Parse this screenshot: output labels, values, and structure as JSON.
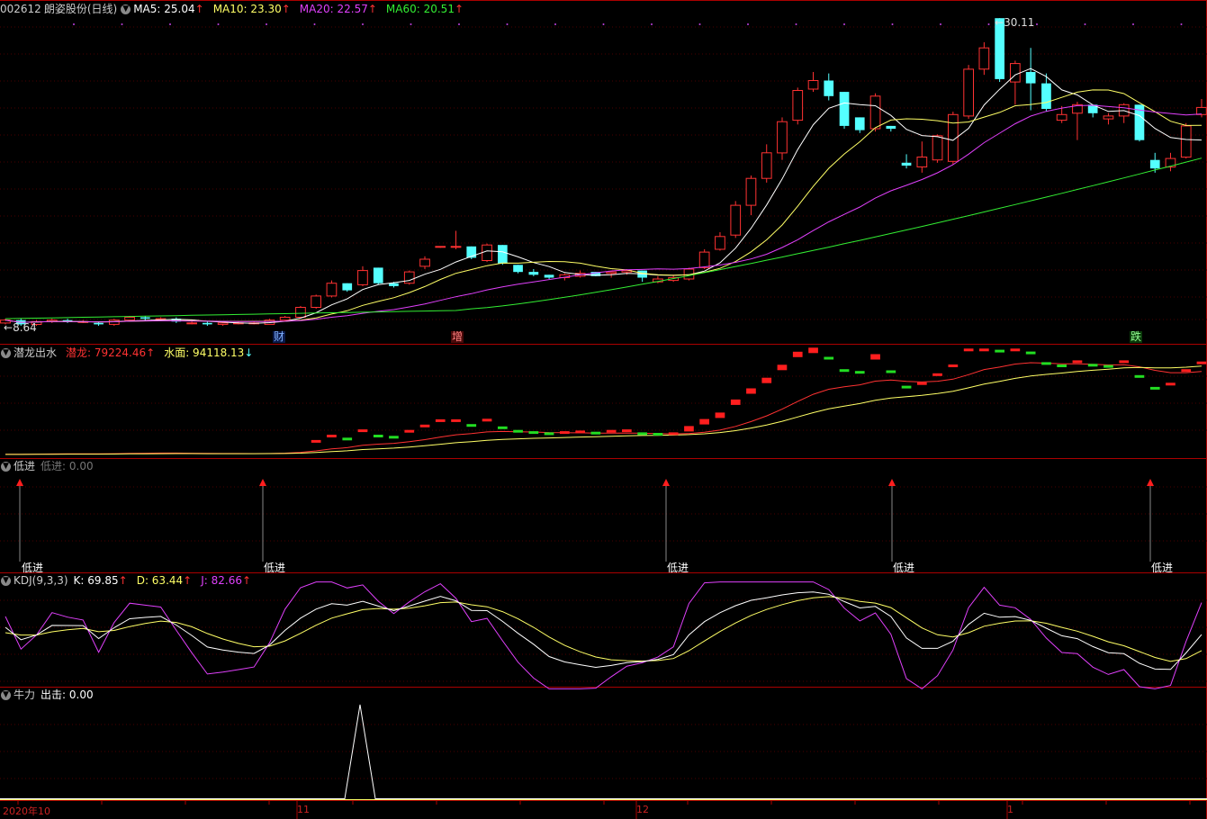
{
  "main": {
    "code": "002612",
    "name": "朗姿股份",
    "period": "(日线)",
    "ma": [
      {
        "label": "MA5: 25.04",
        "arrow": "↑",
        "color": "#ffffff"
      },
      {
        "label": "MA10: 23.30",
        "arrow": "↑",
        "color": "#ffff66"
      },
      {
        "label": "MA20: 22.57",
        "arrow": "↑",
        "color": "#e040fb"
      },
      {
        "label": "MA60: 20.51",
        "arrow": "↑",
        "color": "#33ee33"
      }
    ],
    "high_label": "30.11",
    "low_label": "8.64",
    "events": [
      "财",
      "增",
      "跌"
    ]
  },
  "panel2": {
    "title": "潜龙出水",
    "qianlong": "潜龙: 79224.46",
    "qianlong_arrow": "↑",
    "shuimian": "水面: 94118.13",
    "shuimian_arrow": "↓"
  },
  "panel3": {
    "title": "低进",
    "value": "低进: 0.00",
    "signal_label": "低进"
  },
  "panel4": {
    "title": "KDJ(9,3,3)",
    "k": "K: 69.85",
    "k_arrow": "↑",
    "d": "D: 63.44",
    "d_arrow": "↑",
    "j": "J: 82.66",
    "j_arrow": "↑"
  },
  "panel5": {
    "title": "牛力",
    "value": "出击: 0.00"
  },
  "dates": [
    "2020年10",
    "11",
    "12",
    "1"
  ],
  "colors": {
    "up": "#ff3232",
    "down": "#54ffff",
    "ma5": "#ffffff",
    "ma10": "#ffff66",
    "ma20": "#e040fb",
    "ma60": "#33ee33",
    "divider": "#aa0000"
  },
  "chart_data": {
    "type": "candlestick",
    "candles": [
      [
        8.6,
        8.9,
        8.5,
        8.8
      ],
      [
        8.8,
        8.9,
        8.4,
        8.5
      ],
      [
        8.5,
        8.8,
        8.4,
        8.7
      ],
      [
        8.7,
        8.9,
        8.6,
        8.8
      ],
      [
        8.8,
        8.9,
        8.6,
        8.7
      ],
      [
        8.7,
        8.8,
        8.6,
        8.7
      ],
      [
        8.6,
        8.7,
        8.4,
        8.5
      ],
      [
        8.5,
        8.9,
        8.4,
        8.8
      ],
      [
        8.8,
        9.1,
        8.7,
        9.0
      ],
      [
        9.0,
        9.1,
        8.8,
        8.9
      ],
      [
        8.9,
        9.0,
        8.8,
        8.9
      ],
      [
        8.9,
        9.0,
        8.6,
        8.7
      ],
      [
        8.6,
        8.7,
        8.5,
        8.6
      ],
      [
        8.6,
        8.7,
        8.4,
        8.5
      ],
      [
        8.5,
        8.7,
        8.4,
        8.6
      ],
      [
        8.6,
        8.7,
        8.5,
        8.6
      ],
      [
        8.6,
        8.7,
        8.5,
        8.6
      ],
      [
        8.5,
        8.9,
        8.5,
        8.8
      ],
      [
        8.8,
        9.1,
        8.7,
        9.0
      ],
      [
        9.0,
        9.8,
        9.0,
        9.7
      ],
      [
        9.7,
        10.6,
        9.6,
        10.5
      ],
      [
        10.5,
        11.6,
        10.4,
        11.4
      ],
      [
        11.4,
        11.4,
        10.8,
        10.9
      ],
      [
        11.3,
        12.6,
        11.2,
        12.3
      ],
      [
        12.5,
        12.5,
        11.3,
        11.4
      ],
      [
        11.4,
        11.5,
        11.1,
        11.2
      ],
      [
        11.4,
        12.3,
        11.3,
        12.2
      ],
      [
        12.6,
        13.3,
        12.4,
        13.1
      ],
      [
        14.0,
        14.0,
        13.9,
        14.0
      ],
      [
        14.0,
        15.1,
        13.8,
        14.0
      ],
      [
        14.0,
        14.0,
        13.1,
        13.2
      ],
      [
        13.0,
        14.2,
        12.9,
        14.1
      ],
      [
        14.1,
        14.1,
        12.7,
        12.8
      ],
      [
        12.7,
        12.7,
        12.1,
        12.2
      ],
      [
        12.2,
        12.4,
        11.9,
        12.0
      ],
      [
        12.0,
        12.0,
        11.7,
        11.8
      ],
      [
        11.8,
        12.1,
        11.6,
        12.0
      ],
      [
        11.9,
        12.3,
        11.8,
        12.1
      ],
      [
        12.2,
        12.2,
        11.9,
        11.9
      ],
      [
        12.1,
        12.3,
        11.8,
        12.2
      ],
      [
        12.2,
        12.4,
        12.0,
        12.3
      ],
      [
        12.3,
        12.3,
        11.5,
        11.8
      ],
      [
        11.5,
        11.9,
        11.4,
        11.7
      ],
      [
        11.6,
        12.0,
        11.5,
        11.8
      ],
      [
        11.7,
        12.5,
        11.6,
        12.4
      ],
      [
        12.5,
        13.8,
        12.4,
        13.6
      ],
      [
        13.8,
        15.0,
        13.7,
        14.7
      ],
      [
        14.8,
        17.2,
        14.6,
        16.9
      ],
      [
        16.9,
        19.0,
        16.2,
        18.8
      ],
      [
        18.8,
        21.2,
        18.5,
        20.6
      ],
      [
        20.6,
        23.1,
        20.1,
        22.8
      ],
      [
        22.9,
        25.2,
        22.6,
        25.0
      ],
      [
        25.1,
        26.3,
        24.9,
        25.7
      ],
      [
        25.7,
        26.2,
        24.3,
        24.6
      ],
      [
        24.9,
        24.9,
        22.3,
        22.5
      ],
      [
        23.1,
        23.1,
        22.0,
        22.2
      ],
      [
        22.3,
        24.8,
        22.1,
        24.6
      ],
      [
        22.5,
        22.5,
        22.1,
        22.3
      ],
      [
        19.9,
        20.5,
        19.5,
        19.7
      ],
      [
        19.6,
        21.4,
        19.2,
        20.3
      ],
      [
        20.1,
        21.9,
        19.9,
        21.8
      ],
      [
        20.0,
        23.5,
        19.8,
        23.3
      ],
      [
        23.2,
        26.8,
        23.0,
        26.5
      ],
      [
        26.5,
        28.4,
        26.1,
        28.0
      ],
      [
        30.1,
        30.1,
        25.6,
        25.8
      ],
      [
        25.6,
        27.1,
        24.0,
        26.9
      ],
      [
        26.3,
        28.0,
        23.6,
        25.5
      ],
      [
        25.5,
        26.2,
        23.5,
        23.7
      ],
      [
        22.9,
        23.9,
        22.7,
        23.3
      ],
      [
        23.4,
        24.2,
        21.5,
        24.0
      ],
      [
        24.0,
        24.0,
        23.1,
        23.4
      ],
      [
        23.0,
        23.4,
        22.6,
        23.2
      ],
      [
        23.2,
        24.1,
        22.7,
        24.0
      ],
      [
        24.0,
        24.0,
        21.4,
        21.5
      ],
      [
        20.1,
        20.6,
        19.2,
        19.5
      ],
      [
        19.6,
        20.6,
        19.3,
        20.2
      ],
      [
        20.3,
        22.7,
        20.2,
        22.5
      ],
      [
        23.3,
        24.4,
        23.1,
        23.8
      ]
    ]
  }
}
